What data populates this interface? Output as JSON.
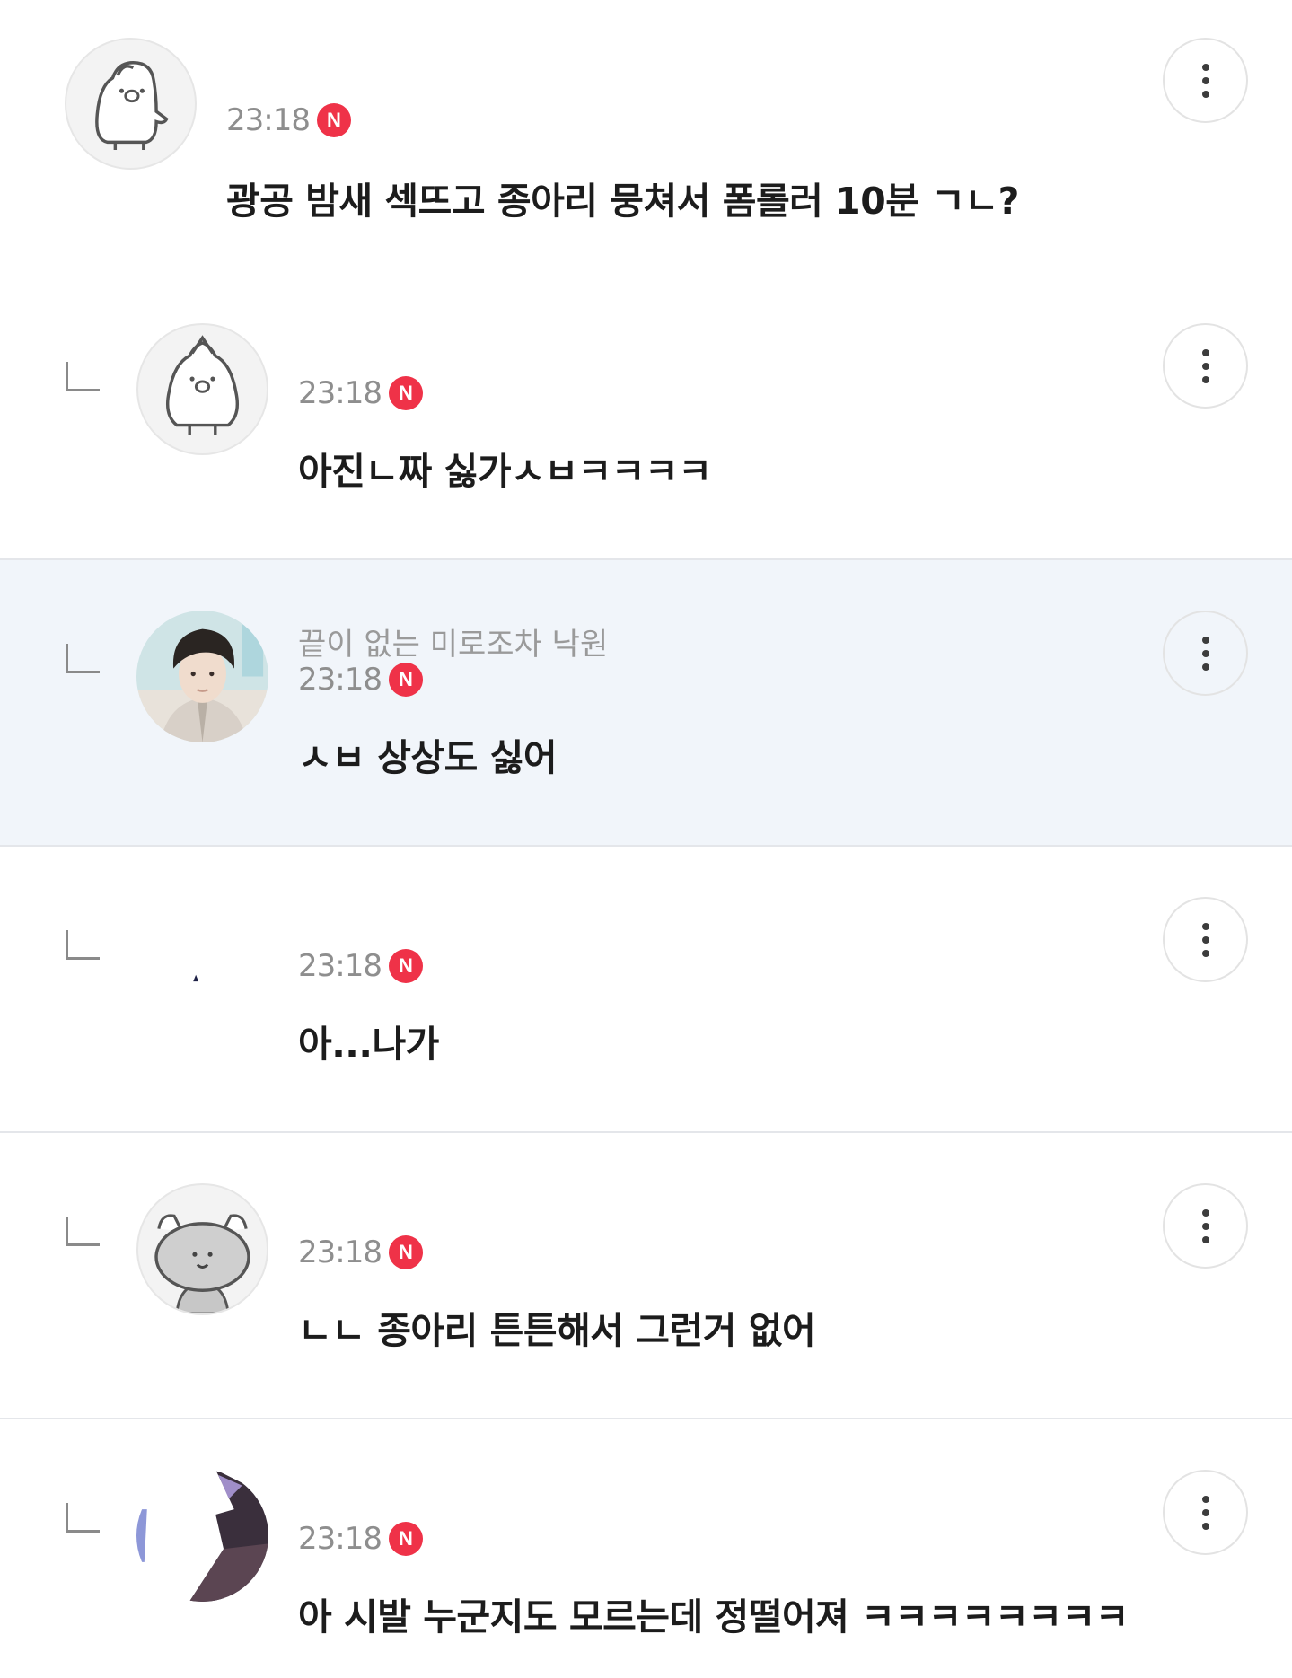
{
  "comments": [
    {
      "nickname": "",
      "time": "23:18",
      "badge": "N",
      "text": "광공 밤새 섹뜨고 종아리 뭉쳐서 폼롤러 10분 ㄱㄴ?",
      "avatar_icon": "penguin-icon"
    },
    {
      "nickname": "",
      "time": "23:18",
      "badge": "N",
      "text": "아진ㄴ짜 싫가ㅅㅂㅋㅋㅋㅋ",
      "avatar_icon": "penguin-icon"
    },
    {
      "nickname": "끝이 없는 미로조차 낙원",
      "time": "23:18",
      "badge": "N",
      "text": "ㅅㅂ 상상도 싫어",
      "avatar_icon": "profile-photo"
    },
    {
      "nickname": "",
      "time": "23:18",
      "badge": "N",
      "text": "아...나가",
      "avatar_icon": "hidden-avatar"
    },
    {
      "nickname": "",
      "time": "23:18",
      "badge": "N",
      "text": "ㄴㄴ 종아리 튼튼해서 그런거 없어",
      "avatar_icon": "cat-icon"
    },
    {
      "nickname": "",
      "time": "23:18",
      "badge": "N",
      "text": "아 시발 누군지도 모르는데 정떨어져 ㅋㅋㅋㅋㅋㅋㅋㅋ",
      "avatar_icon": "profile-photo"
    }
  ],
  "colors": {
    "new_badge": "#ef3248",
    "highlight_row": "#f1f5fa",
    "divider": "#e4e6ea"
  }
}
